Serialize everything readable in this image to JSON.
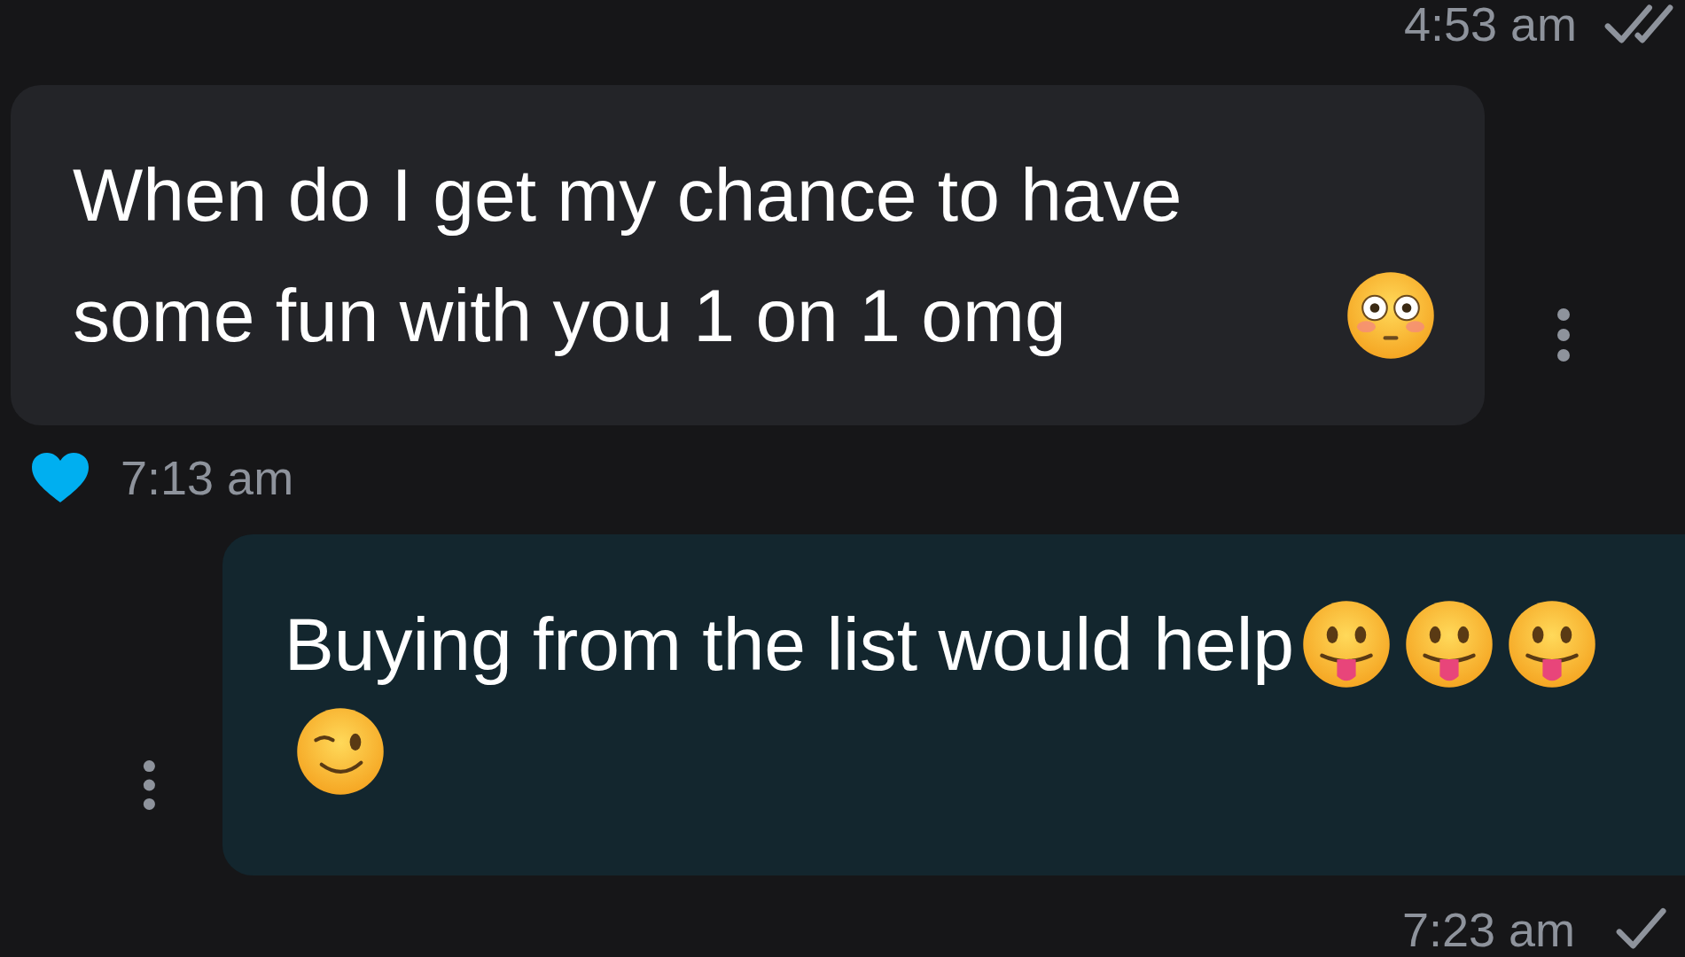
{
  "top_status": {
    "time": "4:53 am",
    "read": true
  },
  "messages": [
    {
      "kind": "incoming",
      "text": "When do I get my chance to have some fun with you 1 on 1 omg",
      "emojis": [
        {
          "kind": "flushed"
        }
      ],
      "liked": true,
      "time": "7:13 am"
    },
    {
      "kind": "outgoing",
      "text": "Buying from the list would help",
      "emojis": [
        {
          "kind": "tongue"
        },
        {
          "kind": "tongue"
        },
        {
          "kind": "tongue"
        },
        {
          "kind": "wink"
        }
      ],
      "time": "7:23 am",
      "read": false
    }
  ]
}
